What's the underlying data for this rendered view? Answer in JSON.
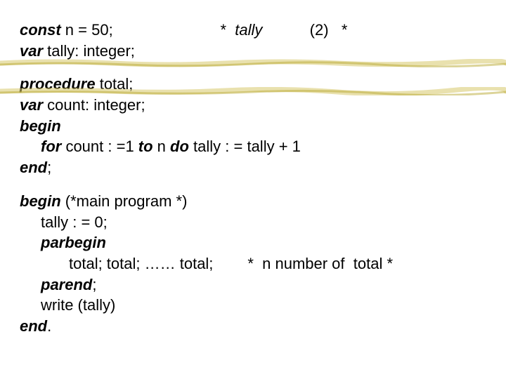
{
  "code": {
    "l1_kw": "const",
    "l1_rest": " n = 50;                         ",
    "l1_cm_star": "*  ",
    "l1_cm_tally": "tally",
    "l1_cm_rest": "           (2)   *",
    "l2_kw": "var",
    "l2_rest": " tally: integer;",
    "l3_kw": "procedure",
    "l3_rest": " total;",
    "l4_kw": "var",
    "l4_rest": " count: integer;",
    "l5_kw": "begin",
    "l6_for": "for",
    "l6_a": " count : =1 ",
    "l6_to": "to",
    "l6_b": " n ",
    "l6_do": "do",
    "l6_c": " tally : = tally + 1",
    "l7_kw": "end",
    "l7_sc": ";",
    "l8_kw": "begin",
    "l8_rest": " (*main program *)",
    "l9": "tally : = 0;",
    "l10_kw": "parbegin",
    "l11_a": "total; total; …… total;",
    "l11_b": "        *  n number of  total *",
    "l12_kw": "parend",
    "l12_sc": ";",
    "l13": "write (tally)",
    "l14_kw": "end",
    "l14_dot": "."
  }
}
